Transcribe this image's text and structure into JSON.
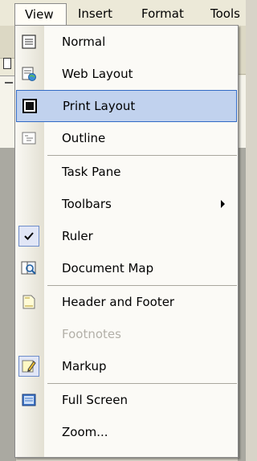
{
  "menubar": {
    "items": [
      "View",
      "Insert",
      "Format",
      "Tools"
    ]
  },
  "menu": {
    "items": [
      {
        "label": "Normal",
        "icon": "normal-view-icon"
      },
      {
        "label": "Web Layout",
        "icon": "web-layout-icon"
      },
      {
        "label": "Print Layout",
        "icon": "print-layout-icon",
        "highlighted": true
      },
      {
        "label": "Outline",
        "icon": "outline-view-icon"
      },
      {
        "label": "Task Pane"
      },
      {
        "label": "Toolbars",
        "submenu": true
      },
      {
        "label": "Ruler",
        "checked": true
      },
      {
        "label": "Document Map",
        "icon": "document-map-icon"
      },
      {
        "label": "Header and Footer",
        "icon": "header-footer-icon"
      },
      {
        "label": "Footnotes",
        "disabled": true
      },
      {
        "label": "Markup",
        "icon": "markup-icon"
      },
      {
        "label": "Full Screen",
        "icon": "full-screen-icon"
      },
      {
        "label": "Zoom..."
      }
    ]
  },
  "colors": {
    "highlight_fill": "#c1d2ee",
    "highlight_border": "#316ac5",
    "disabled_text": "#b3b0a8"
  }
}
